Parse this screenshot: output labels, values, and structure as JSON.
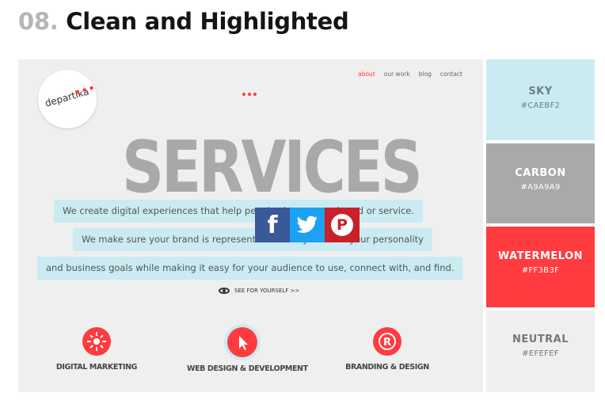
{
  "heading": {
    "number": "08.",
    "title": "Clean and Highlighted"
  },
  "mockup": {
    "logo": "departika",
    "nav": [
      "about",
      "our work",
      "blog",
      "contact"
    ],
    "hero_word": "SERVICES",
    "lines": [
      "We create digital experiences that help people choose your brand or service.",
      "We make sure your brand is represented in a way that fits your personality",
      "and business goals while making it easy for your audience to use, connect with, and find."
    ],
    "see_link": "SEE FOR YOURSELF >>",
    "features": [
      {
        "label": "DIGITAL MARKETING",
        "icon": "target-icon"
      },
      {
        "label": "WEB DESIGN & DEVELOPMENT",
        "icon": "cursor-icon"
      },
      {
        "label": "BRANDING & DESIGN",
        "icon": "registered-icon"
      }
    ]
  },
  "share": {
    "facebook": "f",
    "pinterest": "P"
  },
  "palette": [
    {
      "name": "SKY",
      "hex": "#CAEBF2"
    },
    {
      "name": "CARBON",
      "hex": "#A9A9A9"
    },
    {
      "name": "WATERMELON",
      "hex": "#FF3B3F"
    },
    {
      "name": "NEUTRAL",
      "hex": "#EFEFEF"
    }
  ],
  "colors": {
    "sky": "#caebf2",
    "carbon": "#a9a9a9",
    "watermelon": "#ff3b3f",
    "neutral": "#efefef"
  }
}
